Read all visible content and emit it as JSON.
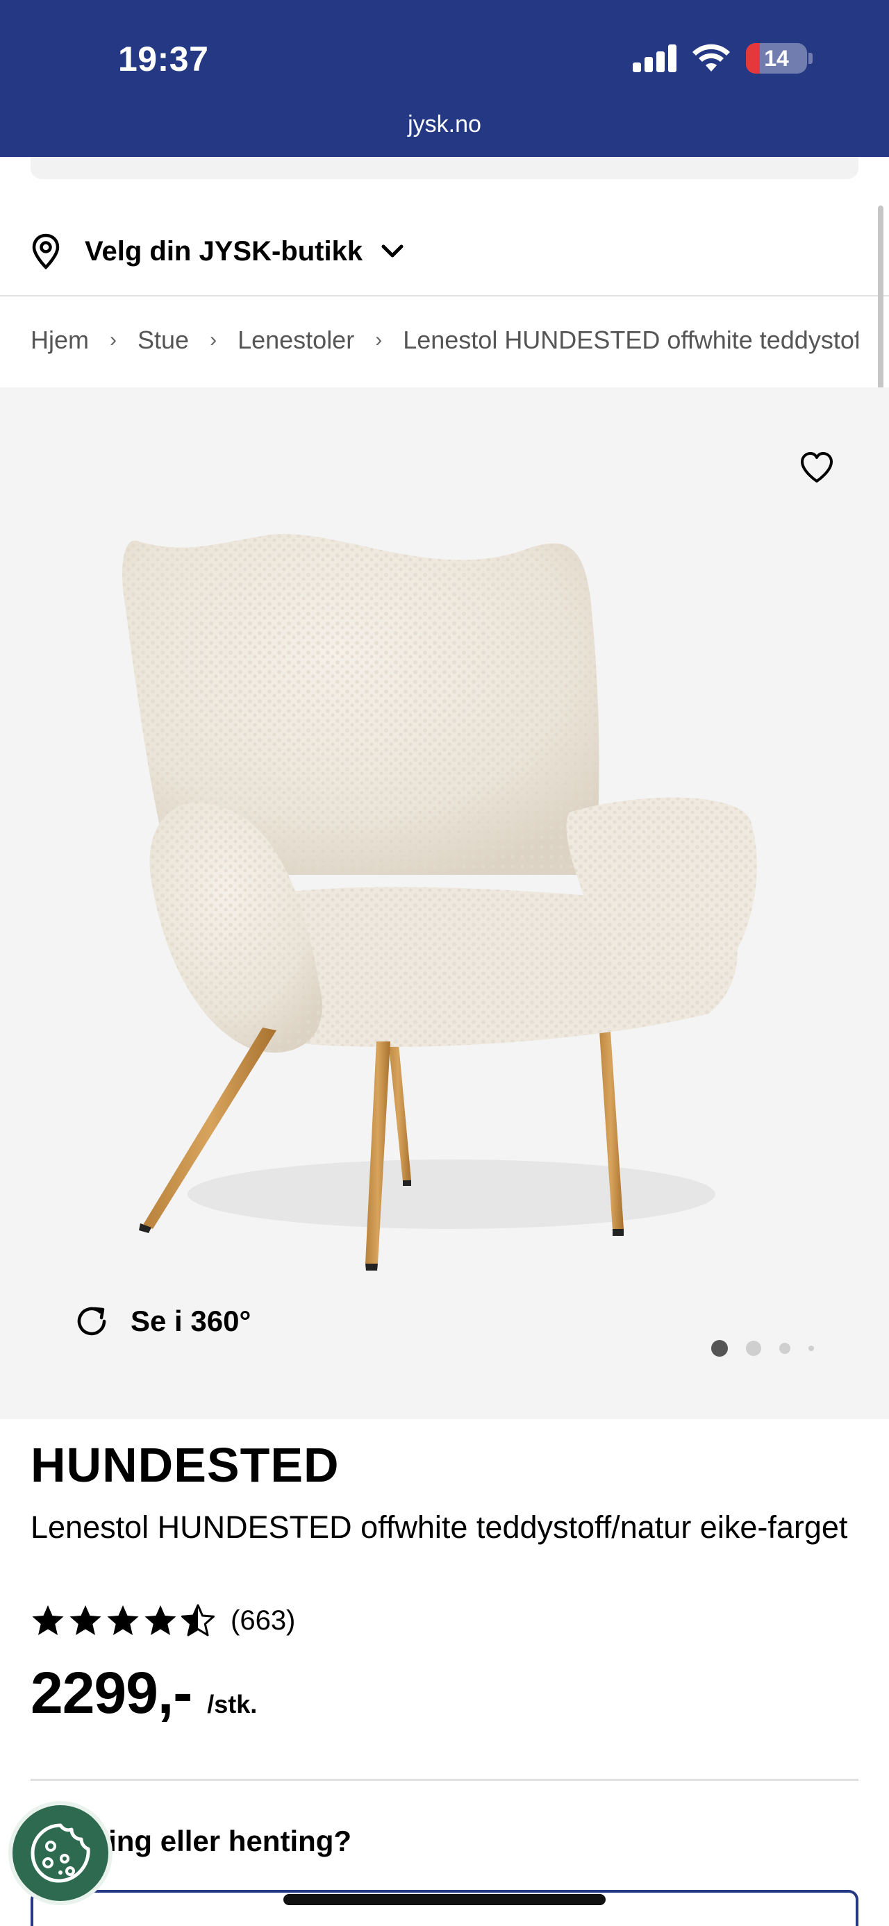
{
  "status_bar": {
    "time": "19:37",
    "battery_level": "14",
    "icons": [
      "signal-icon",
      "wifi-icon",
      "battery-icon"
    ]
  },
  "browser": {
    "url": "jysk.no"
  },
  "store_selector": {
    "label": "Velg din JYSK-butikk",
    "icons": [
      "location-pin-icon",
      "chevron-down-icon"
    ]
  },
  "breadcrumb": {
    "items": [
      "Hjem",
      "Stue",
      "Lenestoler",
      "Lenestol HUNDESTED offwhite teddystoff/natur eike-farget"
    ],
    "separator": "›"
  },
  "gallery": {
    "favorite_icon": "heart-outline-icon",
    "image_alt": "Lenestol HUNDESTED offwhite teddystoff med eikefargede ben",
    "view_360_label": "Se i 360°",
    "current_image": 1,
    "total_images": 4
  },
  "product": {
    "brand": "HUNDESTED",
    "title": "Lenestol HUNDESTED offwhite teddystoff/natur eike-farget",
    "rating": 4.5,
    "rating_max": 5,
    "review_count": "(663)",
    "price": "2299,-",
    "price_unit": "/stk."
  },
  "delivery": {
    "heading": "Levering eller henting?"
  },
  "colors": {
    "brand_blue": "#243883",
    "cookie_green": "#2d6a4f"
  }
}
